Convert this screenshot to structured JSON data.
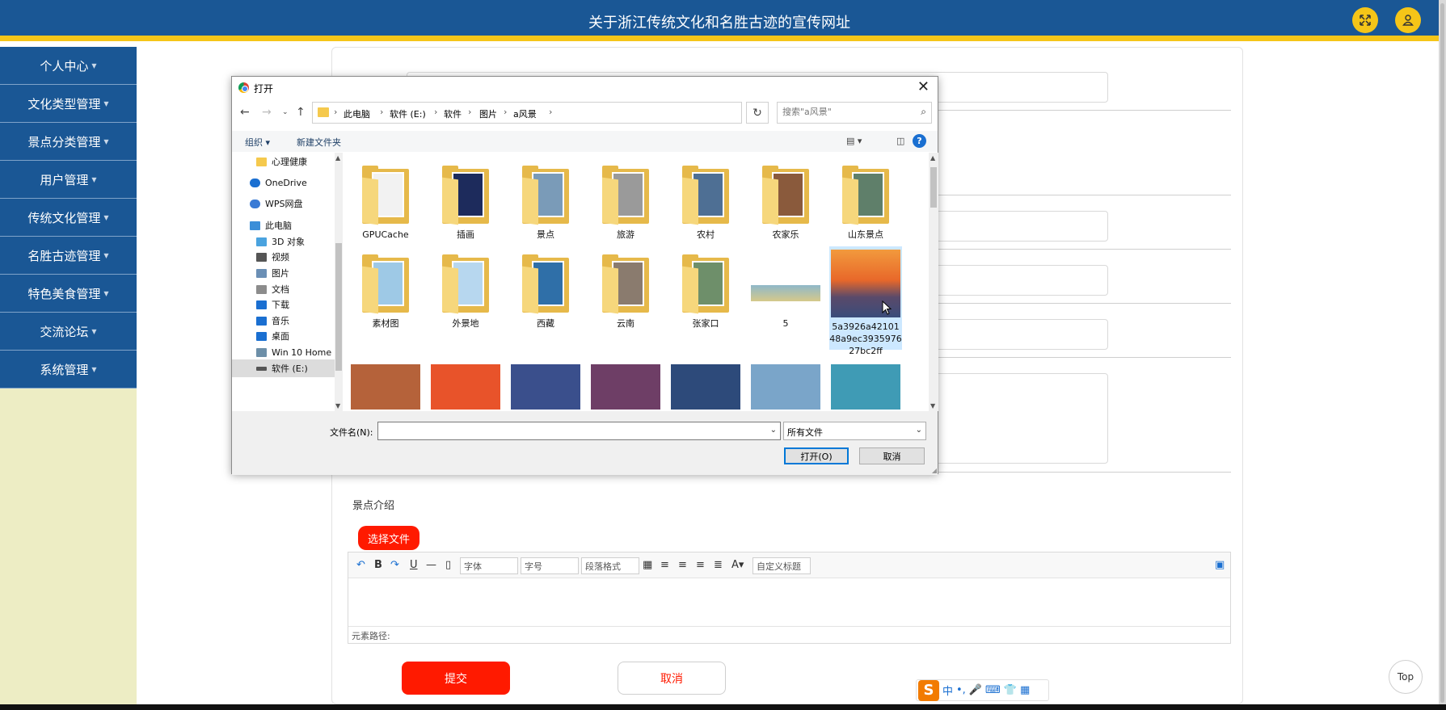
{
  "header": {
    "title": "关于浙江传统文化和名胜古迹的宣传网址",
    "fullscreen_icon": "expand-icon",
    "user_icon": "user-icon",
    "accent": "#f5c518",
    "bg": "#1a5795"
  },
  "sidebar": {
    "items": [
      {
        "label": "个人中心"
      },
      {
        "label": "文化类型管理"
      },
      {
        "label": "景点分类管理"
      },
      {
        "label": "用户管理"
      },
      {
        "label": "传统文化管理"
      },
      {
        "label": "名胜古迹管理"
      },
      {
        "label": "特色美食管理"
      },
      {
        "label": "交流论坛"
      },
      {
        "label": "系统管理"
      }
    ]
  },
  "form": {
    "intro_label": "景点介绍",
    "choose_file": "选择文件",
    "editor": {
      "font_select": "字体",
      "size_select": "字号",
      "para_select": "段落格式",
      "custom_select": "自定义标题",
      "path_label": "元素路径:"
    },
    "submit": "提交",
    "cancel": "取消"
  },
  "ime": {
    "lang": "中"
  },
  "top_button": "Top",
  "dialog": {
    "title": "打开",
    "breadcrumbs": [
      "此电脑",
      "软件 (E:)",
      "软件",
      "图片",
      "a风景"
    ],
    "search_placeholder": "搜索\"a风景\"",
    "organize": "组织 ▾",
    "new_folder": "新建文件夹",
    "nav_items": [
      {
        "label": "心理健康",
        "icon": "folder-icon",
        "color": "#f5c94d"
      },
      {
        "label": "OneDrive",
        "icon": "cloud-icon",
        "color": "#1a6fd1"
      },
      {
        "label": "WPS网盘",
        "icon": "cloud-icon",
        "color": "#3a7bd5"
      },
      {
        "label": "此电脑",
        "icon": "computer-icon",
        "color": "#3b8ed8"
      },
      {
        "label": "3D 对象",
        "icon": "cube-icon",
        "color": "#4aa3df"
      },
      {
        "label": "视频",
        "icon": "video-icon",
        "color": "#555555"
      },
      {
        "label": "图片",
        "icon": "pictures-icon",
        "color": "#6b8fb5"
      },
      {
        "label": "文档",
        "icon": "document-icon",
        "color": "#8c8c8c"
      },
      {
        "label": "下载",
        "icon": "download-icon",
        "color": "#1a6fd1"
      },
      {
        "label": "音乐",
        "icon": "music-icon",
        "color": "#1a6fd1"
      },
      {
        "label": "桌面",
        "icon": "desktop-icon",
        "color": "#1a6fd1"
      },
      {
        "label": "Win 10 Home",
        "icon": "drive-icon",
        "color": "#6d8fa8"
      },
      {
        "label": "软件 (E:)",
        "icon": "drive-icon",
        "color": "#555555"
      }
    ],
    "folders_row1": [
      {
        "name": "GPUCache",
        "pic": "#f2f2f2"
      },
      {
        "name": "插画",
        "pic": "#1d2b5c"
      },
      {
        "name": "景点",
        "pic": "#7a9bb8"
      },
      {
        "name": "旅游",
        "pic": "#9a9a9a"
      },
      {
        "name": "农村",
        "pic": "#4e6f94"
      },
      {
        "name": "农家乐",
        "pic": "#8a5a3c"
      },
      {
        "name": "山东景点",
        "pic": "#5f7f6a"
      }
    ],
    "folders_row2": [
      {
        "name": "素材图",
        "pic": "#9ec9e6"
      },
      {
        "name": "外景地",
        "pic": "#b7d7ef"
      },
      {
        "name": "西藏",
        "pic": "#2f6fa8"
      },
      {
        "name": "云南",
        "pic": "#8a7b6e"
      },
      {
        "name": "张家口",
        "pic": "#6e8f6a"
      }
    ],
    "file5": "5",
    "selected_file": "5a3926a4210148a9ec393597627bc2ff",
    "thumbs_row3": [
      "#b5623a",
      "#e8532a",
      "#3a4f8c",
      "#6e3e66",
      "#2d4a7a",
      "#7aa5c9",
      "#3f9bb5"
    ],
    "filename_label": "文件名(N):",
    "filename_value": "",
    "filetype": "所有文件",
    "open_btn": "打开(O)",
    "cancel_btn": "取消"
  }
}
